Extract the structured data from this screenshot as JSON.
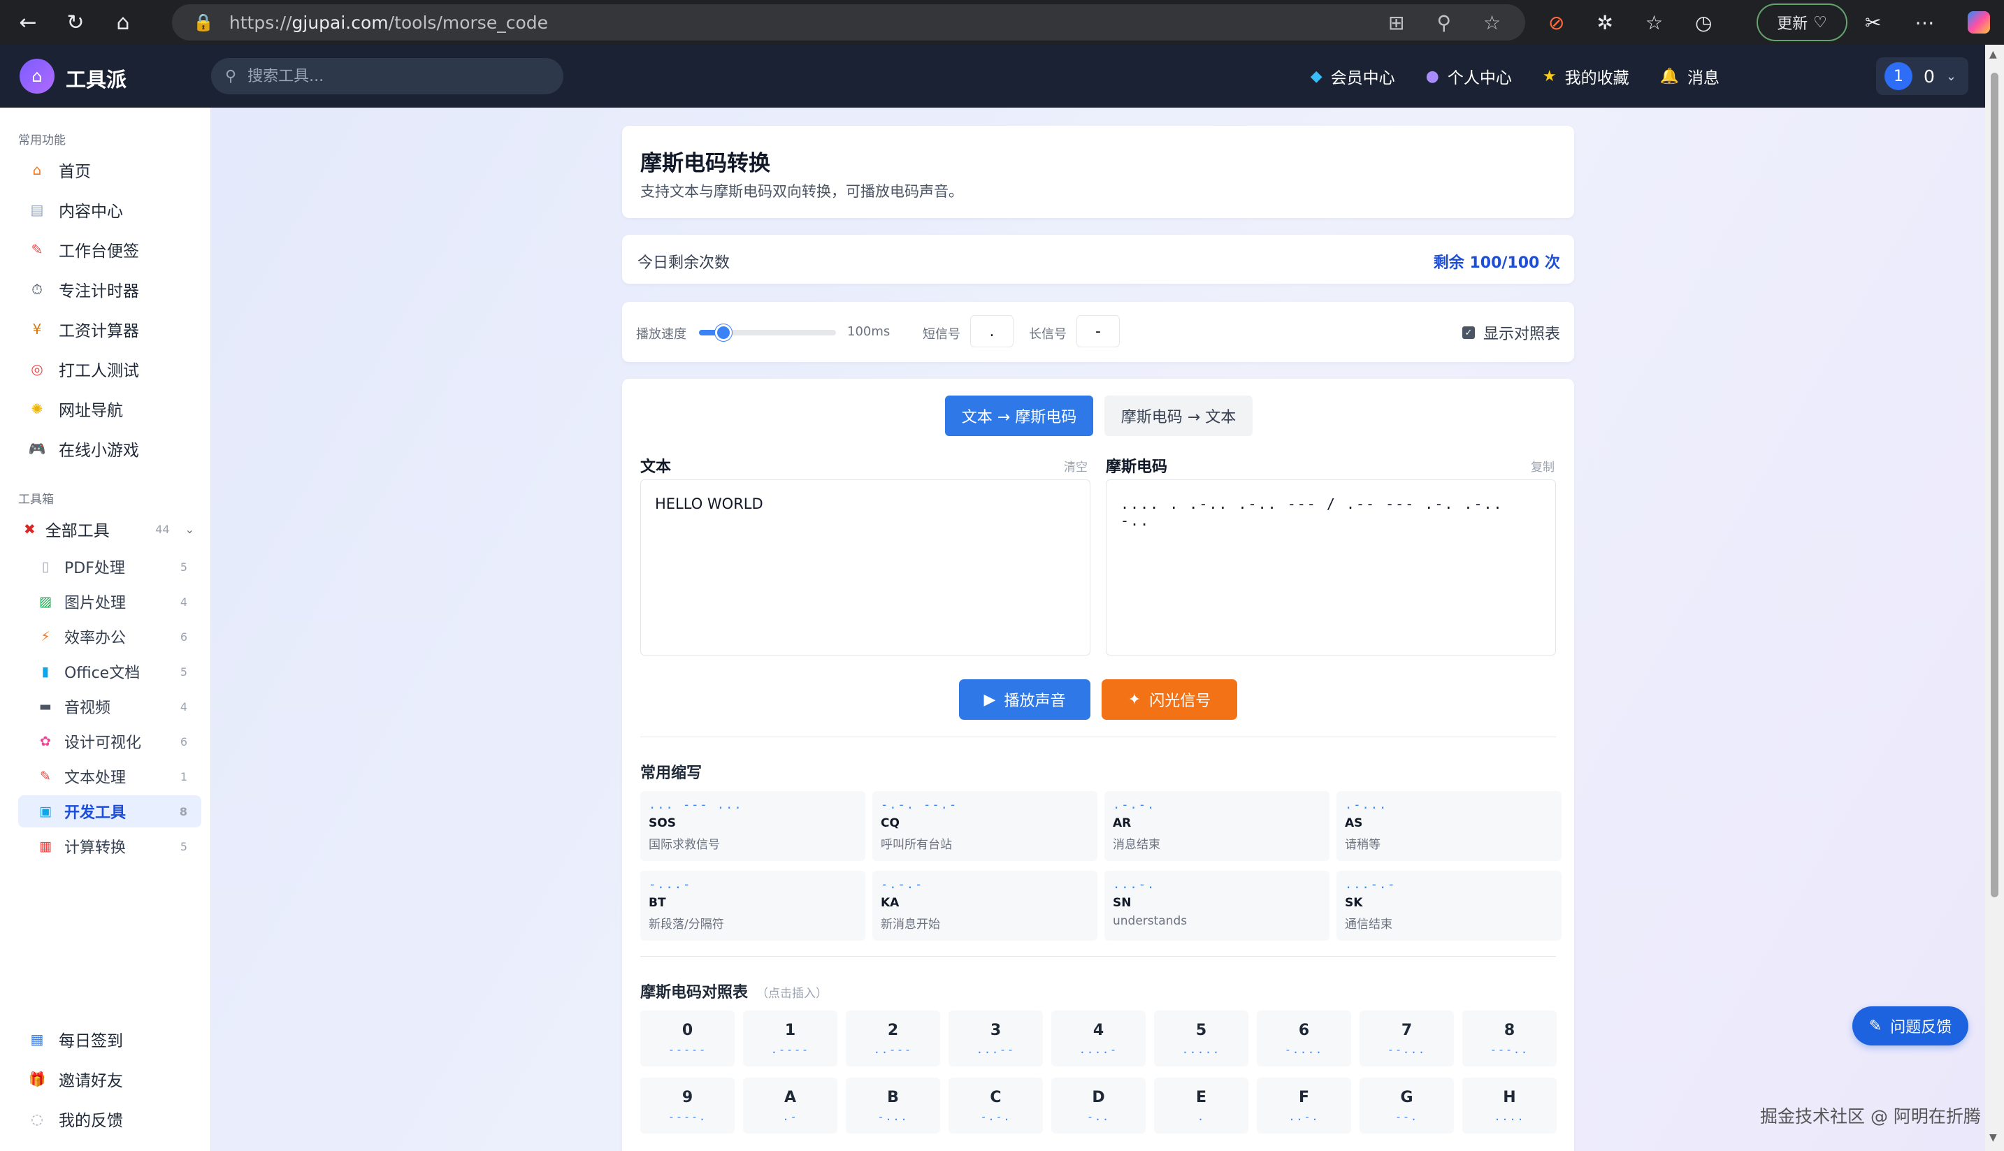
{
  "browser": {
    "url_prefix": "https://",
    "url_host": "gjupai.com",
    "url_path": "/tools/morse_code",
    "update_label": "更新"
  },
  "header": {
    "brand": "工具派",
    "search_placeholder": "搜索工具...",
    "nav": [
      "会员中心",
      "个人中心",
      "我的收藏",
      "消息"
    ],
    "user_badge": "1",
    "user_count": "0"
  },
  "sidebar": {
    "common_title": "常用功能",
    "common_items": [
      {
        "label": "首页",
        "icon": "home-icon"
      },
      {
        "label": "内容中心",
        "icon": "content-icon"
      },
      {
        "label": "工作台便签",
        "icon": "note-icon"
      },
      {
        "label": "专注计时器",
        "icon": "timer-icon"
      },
      {
        "label": "工资计算器",
        "icon": "money-icon"
      },
      {
        "label": "打工人测试",
        "icon": "target-icon"
      },
      {
        "label": "网址导航",
        "icon": "compass-icon"
      },
      {
        "label": "在线小游戏",
        "icon": "gamepad-icon"
      }
    ],
    "toolbox_title": "工具箱",
    "all_tools_label": "全部工具",
    "all_tools_count": "44",
    "tool_categories": [
      {
        "label": "PDF处理",
        "count": "5"
      },
      {
        "label": "图片处理",
        "count": "4"
      },
      {
        "label": "效率办公",
        "count": "6"
      },
      {
        "label": "Office文档",
        "count": "5"
      },
      {
        "label": "音视频",
        "count": "4"
      },
      {
        "label": "设计可视化",
        "count": "6"
      },
      {
        "label": "文本处理",
        "count": "1"
      },
      {
        "label": "开发工具",
        "count": "8"
      },
      {
        "label": "计算转换",
        "count": "5"
      }
    ],
    "bottom_items": [
      "每日签到",
      "邀请好友",
      "我的反馈"
    ]
  },
  "page": {
    "title": "摩斯电码转换",
    "subtitle": "支持文本与摩斯电码双向转换，可播放电码声音。",
    "quota_label": "今日剩余次数",
    "quota_value": "剩余 100/100 次",
    "speed_label": "播放速度",
    "speed_value": "100ms",
    "speed_level": 0.18,
    "short_label": "短信号",
    "short_value": ".",
    "long_label": "长信号",
    "long_value": "-",
    "show_table_label": "显示对照表",
    "show_table_checked": true,
    "mode_active": "文本 → 摩斯电码",
    "mode_inactive": "摩斯电码 → 文本",
    "text_label": "文本",
    "clear_label": "清空",
    "text_value": "HELLO WORLD",
    "morse_label": "摩斯电码",
    "copy_label": "复制",
    "morse_value": ".... . .-.. .-.. --- / .-- --- .-. .-.. -..",
    "play_label": "播放声音",
    "flash_label": "闪光信号",
    "abbr_title": "常用缩写",
    "abbreviations": [
      {
        "code": "... --- ...",
        "name": "SOS",
        "desc": "国际求救信号"
      },
      {
        "code": "-.-. --.-",
        "name": "CQ",
        "desc": "呼叫所有台站"
      },
      {
        "code": ".-.-.",
        "name": "AR",
        "desc": "消息结束"
      },
      {
        "code": ".-...",
        "name": "AS",
        "desc": "请稍等"
      },
      {
        "code": "-...-",
        "name": "BT",
        "desc": "新段落/分隔符"
      },
      {
        "code": "-.-.-",
        "name": "KA",
        "desc": "新消息开始"
      },
      {
        "code": "...-.",
        "name": "SN",
        "desc": "understands"
      },
      {
        "code": "...-.-",
        "name": "SK",
        "desc": "通信结束"
      }
    ],
    "table_title": "摩斯电码对照表",
    "table_hint": "（点击插入）",
    "reference": [
      {
        "ch": "0",
        "code": "-----"
      },
      {
        "ch": "1",
        "code": ".----"
      },
      {
        "ch": "2",
        "code": "..---"
      },
      {
        "ch": "3",
        "code": "...--"
      },
      {
        "ch": "4",
        "code": "....-"
      },
      {
        "ch": "5",
        "code": "....."
      },
      {
        "ch": "6",
        "code": "-...."
      },
      {
        "ch": "7",
        "code": "--..."
      },
      {
        "ch": "8",
        "code": "---.."
      },
      {
        "ch": "9",
        "code": "----."
      },
      {
        "ch": "A",
        "code": ".-"
      },
      {
        "ch": "B",
        "code": "-..."
      },
      {
        "ch": "C",
        "code": "-.-."
      },
      {
        "ch": "D",
        "code": "-.."
      },
      {
        "ch": "E",
        "code": "."
      },
      {
        "ch": "F",
        "code": "..-."
      },
      {
        "ch": "G",
        "code": "--."
      },
      {
        "ch": "H",
        "code": "...."
      }
    ]
  },
  "feedback_label": "问题反馈",
  "watermark": "掘金技术社区 @ 阿明在折腾",
  "colors": {
    "accent": "#2f78e8",
    "flash": "#f47216",
    "header_bg": "#1a2233"
  }
}
